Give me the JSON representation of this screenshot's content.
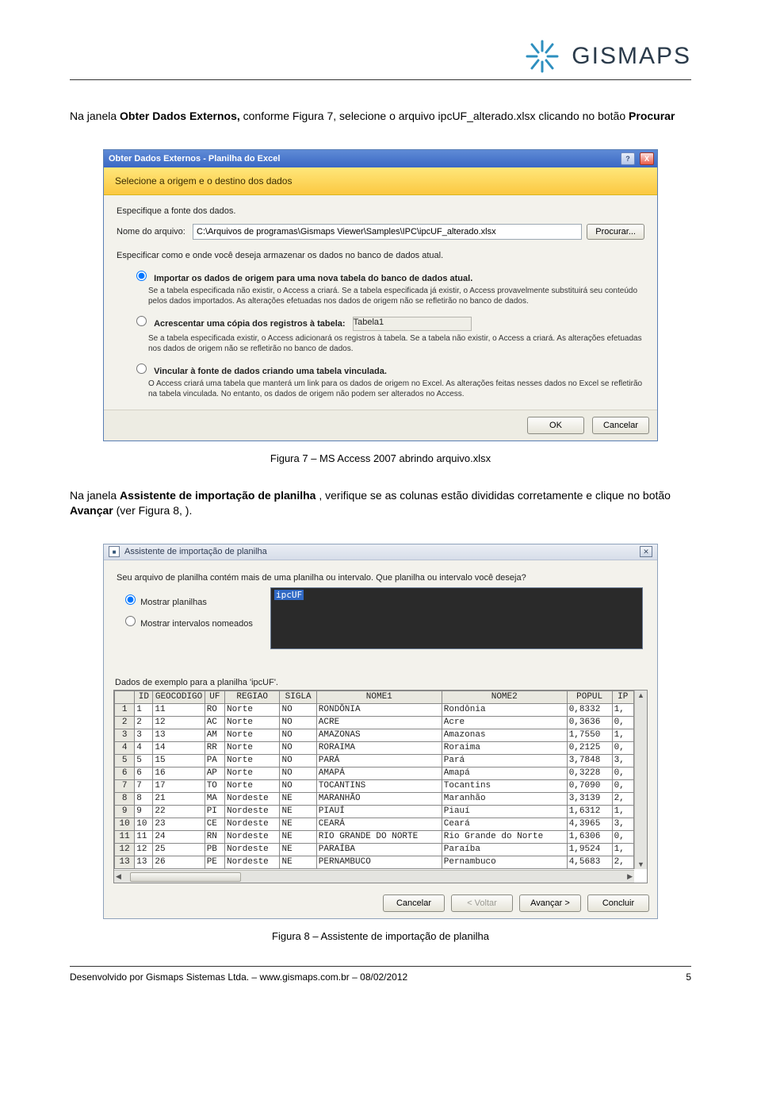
{
  "logo": {
    "text": "GISMAPS"
  },
  "intro_html_parts": {
    "pre": "Na janela ",
    "b1": "Obter Dados Externos,",
    "mid": " conforme Figura 7, selecione o arquivo ipcUF_alterado.xlsx clicando no botão ",
    "b2": "Procurar"
  },
  "dlg1": {
    "title": "Obter Dados Externos - Planilha do Excel",
    "help_tip": "?",
    "close_tip": "X",
    "band": "Selecione a origem e o destino dos dados",
    "spec_label": "Especifique a fonte dos dados.",
    "file_label": "Nome do arquivo:",
    "file_value": "C:\\Arquivos de programas\\Gismaps Viewer\\Samples\\IPC\\ipcUF_alterado.xlsx",
    "browse": "Procurar...",
    "spec2": "Especificar como e onde você deseja armazenar os dados no banco de dados atual.",
    "opt1_label": "Importar os dados de origem para uma nova tabela do banco de dados atual.",
    "opt1_desc": "Se a tabela especificada não existir, o Access a criará. Se a tabela especificada já existir, o Access provavelmente substituirá seu conteúdo pelos dados importados. As alterações efetuadas nos dados de origem não se refletirão no banco de dados.",
    "opt2_label": "Acrescentar uma cópia dos registros à tabela:",
    "opt2_combo": "Tabela1",
    "opt2_desc": "Se a tabela especificada existir, o Access adicionará os registros à tabela. Se a tabela não existir, o Access a criará. As alterações efetuadas nos dados de origem não se refletirão no banco de dados.",
    "opt3_label": "Vincular à fonte de dados criando uma tabela vinculada.",
    "opt3_desc": "O Access criará uma tabela que manterá um link para os dados de origem no Excel. As alterações feitas nesses dados no Excel se refletirão na tabela vinculada. No entanto, os dados de origem não podem ser alterados no Access.",
    "ok": "OK",
    "cancel": "Cancelar"
  },
  "caption1": "Figura 7 – MS Access 2007 abrindo arquivo.xlsx",
  "mid_para": {
    "pre": "Na janela ",
    "b1": "Assistente de importação de planilha",
    "mid": ", verifique se as colunas estão divididas corretamente e clique no botão ",
    "b2": "Avançar",
    "post": " (ver Figura 8, )."
  },
  "dlg2": {
    "title": "Assistente de importação de planilha",
    "close": "✕",
    "intro": "Seu arquivo de planilha contém mais de uma planilha ou intervalo. Que planilha ou intervalo você deseja?",
    "r1": "Mostrar planilhas",
    "r2": "Mostrar intervalos nomeados",
    "list_selected": "ipcUF",
    "grid_title": "Dados de exemplo para a planilha 'ipcUF'.",
    "headers": [
      "",
      "ID",
      "GEOCODIGO",
      "UF",
      "REGIAO",
      "SIGLA",
      "NOME1",
      "NOME2",
      "POPUL",
      "IP"
    ],
    "rows": [
      [
        "1",
        "1",
        "11",
        "RO",
        "Norte",
        "NO",
        "RONDÔNIA",
        "Rondônia",
        "0,8332",
        "1,"
      ],
      [
        "2",
        "2",
        "12",
        "AC",
        "Norte",
        "NO",
        "ACRE",
        "Acre",
        "0,3636",
        "0,"
      ],
      [
        "3",
        "3",
        "13",
        "AM",
        "Norte",
        "NO",
        "AMAZONAS",
        "Amazonas",
        "1,7550",
        "1,"
      ],
      [
        "4",
        "4",
        "14",
        "RR",
        "Norte",
        "NO",
        "RORAIMA",
        "Roraima",
        "0,2125",
        "0,"
      ],
      [
        "5",
        "5",
        "15",
        "PA",
        "Norte",
        "NO",
        "PARÁ",
        "Pará",
        "3,7848",
        "3,"
      ],
      [
        "6",
        "6",
        "16",
        "AP",
        "Norte",
        "NO",
        "AMAPÁ",
        "Amapá",
        "0,3228",
        "0,"
      ],
      [
        "7",
        "7",
        "17",
        "TO",
        "Norte",
        "NO",
        "TOCANTINS",
        "Tocantins",
        "0,7090",
        "0,"
      ],
      [
        "8",
        "8",
        "21",
        "MA",
        "Nordeste",
        "NE",
        "MARANHÃO",
        "Maranhão",
        "3,3139",
        "2,"
      ],
      [
        "9",
        "9",
        "22",
        "PI",
        "Nordeste",
        "NE",
        "PIAUÍ",
        "Piauí",
        "1,6312",
        "1,"
      ],
      [
        "10",
        "10",
        "23",
        "CE",
        "Nordeste",
        "NE",
        "CEARÁ",
        "Ceará",
        "4,3965",
        "3,"
      ],
      [
        "11",
        "11",
        "24",
        "RN",
        "Nordeste",
        "NE",
        "RIO GRANDE DO NORTE",
        "Rio Grande do Norte",
        "1,6306",
        "0,"
      ],
      [
        "12",
        "12",
        "25",
        "PB",
        "Nordeste",
        "NE",
        "PARAÍBA",
        "Paraíba",
        "1,9524",
        "1,"
      ],
      [
        "13",
        "13",
        "26",
        "PE",
        "Nordeste",
        "NE",
        "PERNAMBUCO",
        "Pernambuco",
        "4,5683",
        "2,"
      ]
    ],
    "btn_cancel": "Cancelar",
    "btn_back": "< Voltar",
    "btn_next": "Avançar >",
    "btn_finish": "Concluir"
  },
  "caption2": "Figura 8 – Assistente de importação de planilha",
  "footer": {
    "left": "Desenvolvido por Gismaps Sistemas Ltda. – www.gismaps.com.br – 08/02/2012",
    "right": "5"
  }
}
